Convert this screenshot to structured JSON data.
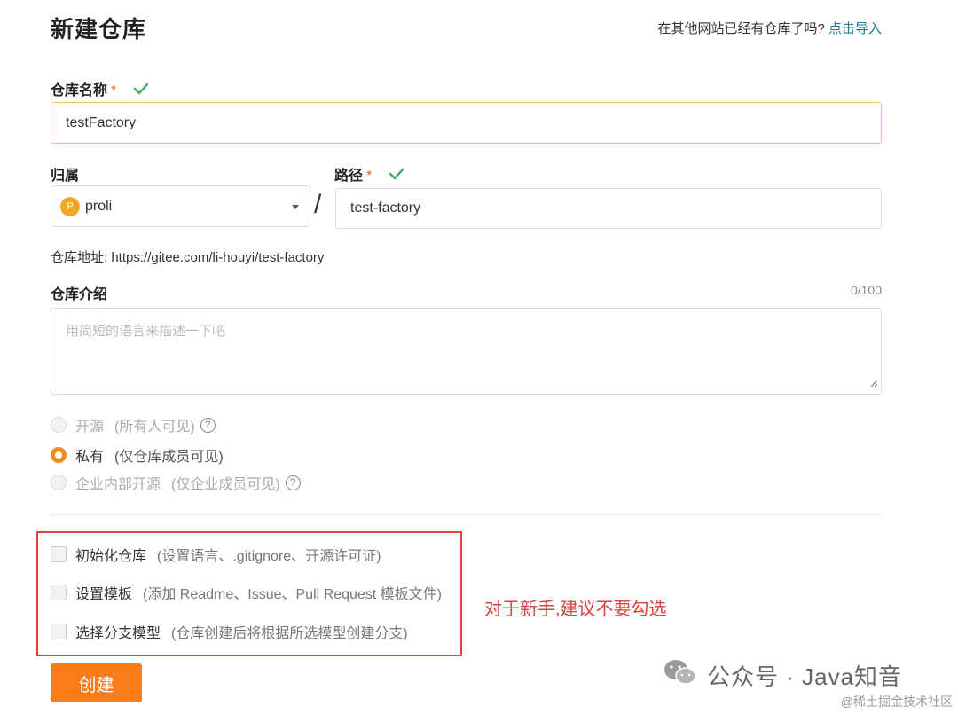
{
  "header": {
    "title": "新建仓库",
    "import_prompt": "在其他网站已经有仓库了吗?",
    "import_link": "点击导入"
  },
  "repo_name": {
    "label": "仓库名称",
    "required_mark": "*",
    "value": "testFactory"
  },
  "owner": {
    "label": "归属",
    "avatar_letter": "P",
    "selected": "proli"
  },
  "path": {
    "label": "路径",
    "required_mark": "*",
    "separator": "/",
    "value": "test-factory"
  },
  "repo_url": "仓库地址: https://gitee.com/li-houyi/test-factory",
  "description": {
    "label": "仓库介绍",
    "counter": "0/100",
    "placeholder": "用简短的语言来描述一下吧"
  },
  "visibility": {
    "options": [
      {
        "label": "开源",
        "hint": "(所有人可见)",
        "checked": false,
        "disabled": true,
        "help": true
      },
      {
        "label": "私有",
        "hint": "(仅仓库成员可见)",
        "checked": true,
        "disabled": false,
        "help": false
      },
      {
        "label": "企业内部开源",
        "hint": "(仅企业成员可见)",
        "checked": false,
        "disabled": true,
        "help": true
      }
    ]
  },
  "init_options": [
    {
      "label": "初始化仓库",
      "hint": "(设置语言、.gitignore、开源许可证)"
    },
    {
      "label": "设置模板",
      "hint": "(添加 Readme、Issue、Pull Request 模板文件)"
    },
    {
      "label": "选择分支模型",
      "hint": "(仓库创建后将根据所选模型创建分支)"
    }
  ],
  "annotation": "对于新手,建议不要勾选",
  "create_button": "创建",
  "watermark": {
    "main": "公众号 · Java知音",
    "sub": "@稀土掘金技术社区"
  },
  "colors": {
    "accent": "#fc7b1b",
    "link": "#1a7a99",
    "valid": "#3daa5c",
    "annotation": "#d9423f"
  }
}
